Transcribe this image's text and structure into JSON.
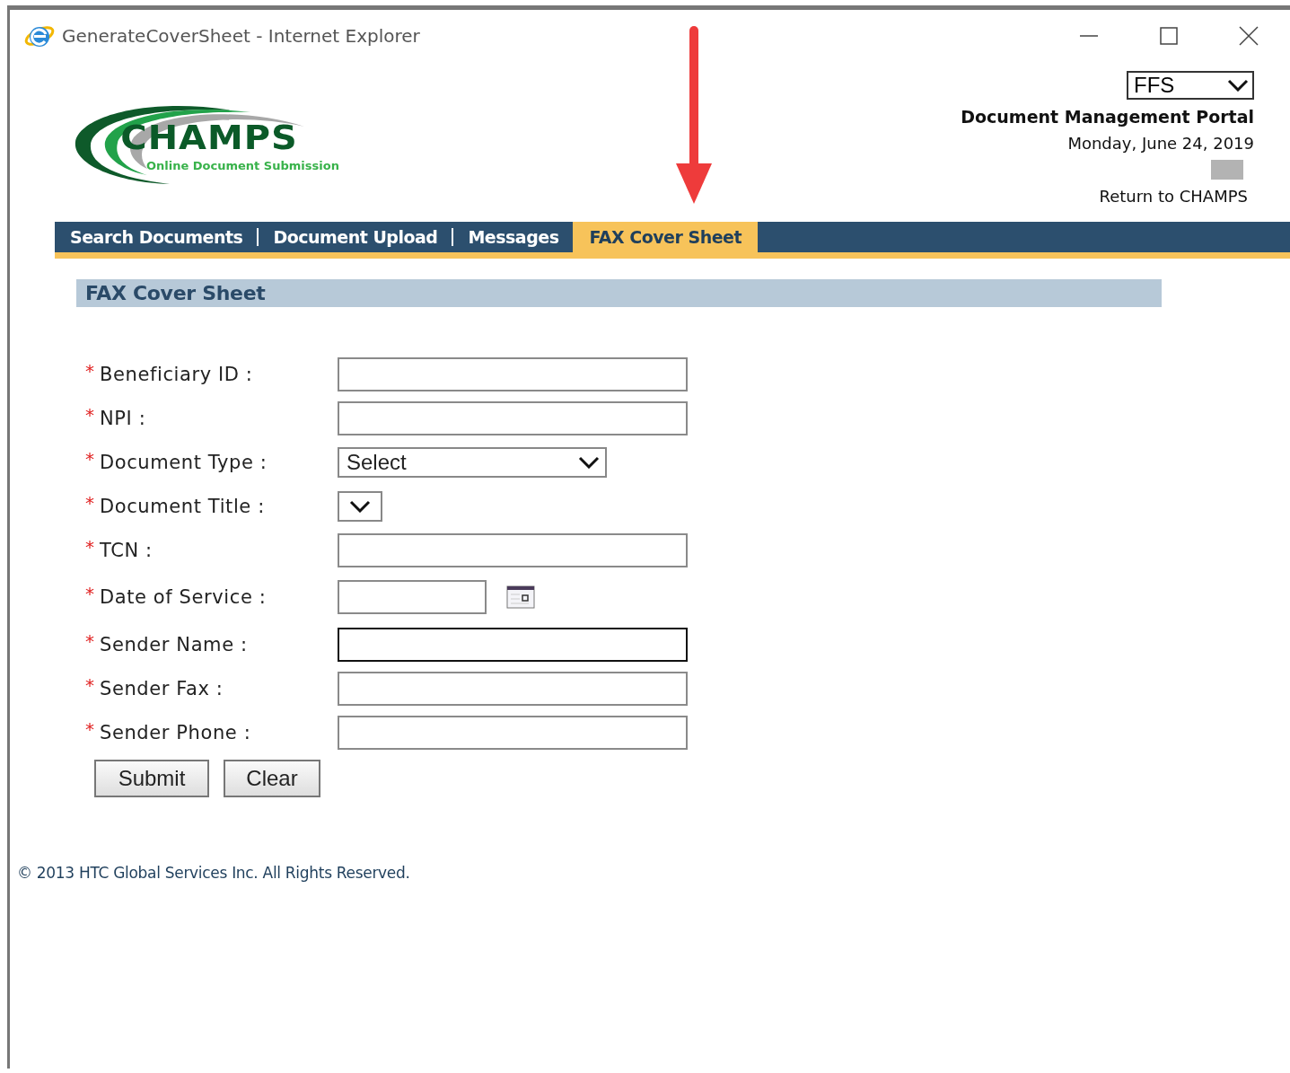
{
  "window": {
    "title": "GenerateCoverSheet - Internet Explorer"
  },
  "logo": {
    "name": "CHAMPS",
    "tagline": "Online Document Submission"
  },
  "header": {
    "program_select": {
      "value": "FFS"
    },
    "portal_title": "Document Management Portal",
    "date": "Monday, June 24, 2019",
    "return_link": "Return to CHAMPS"
  },
  "nav": [
    {
      "label": "Search Documents",
      "selected": false
    },
    {
      "label": "Document Upload",
      "selected": false
    },
    {
      "label": "Messages",
      "selected": false
    },
    {
      "label": "FAX Cover Sheet",
      "selected": true
    }
  ],
  "section": {
    "title": "FAX Cover Sheet"
  },
  "fields": [
    {
      "kind": "text",
      "mark": "*",
      "label": "Beneficiary ID :"
    },
    {
      "kind": "text",
      "mark": "*",
      "label": "NPI :"
    },
    {
      "kind": "select",
      "mark": "*",
      "label": "Document Type :",
      "value": "Select"
    },
    {
      "kind": "small-select",
      "mark": "*",
      "label": "Document Title :"
    },
    {
      "kind": "text",
      "mark": "*",
      "label": "TCN :"
    },
    {
      "kind": "date",
      "mark": "*",
      "label": "Date of Service :"
    },
    {
      "kind": "text",
      "mark": "*",
      "label": "Sender Name :",
      "focused": true
    },
    {
      "kind": "text",
      "mark": "*",
      "label": "Sender Fax :"
    },
    {
      "kind": "text",
      "mark": "*",
      "label": "Sender Phone :"
    }
  ],
  "buttons": [
    "Submit",
    "Clear"
  ],
  "footer": "© 2013 HTC Global Services Inc. All Rights Reserved."
}
